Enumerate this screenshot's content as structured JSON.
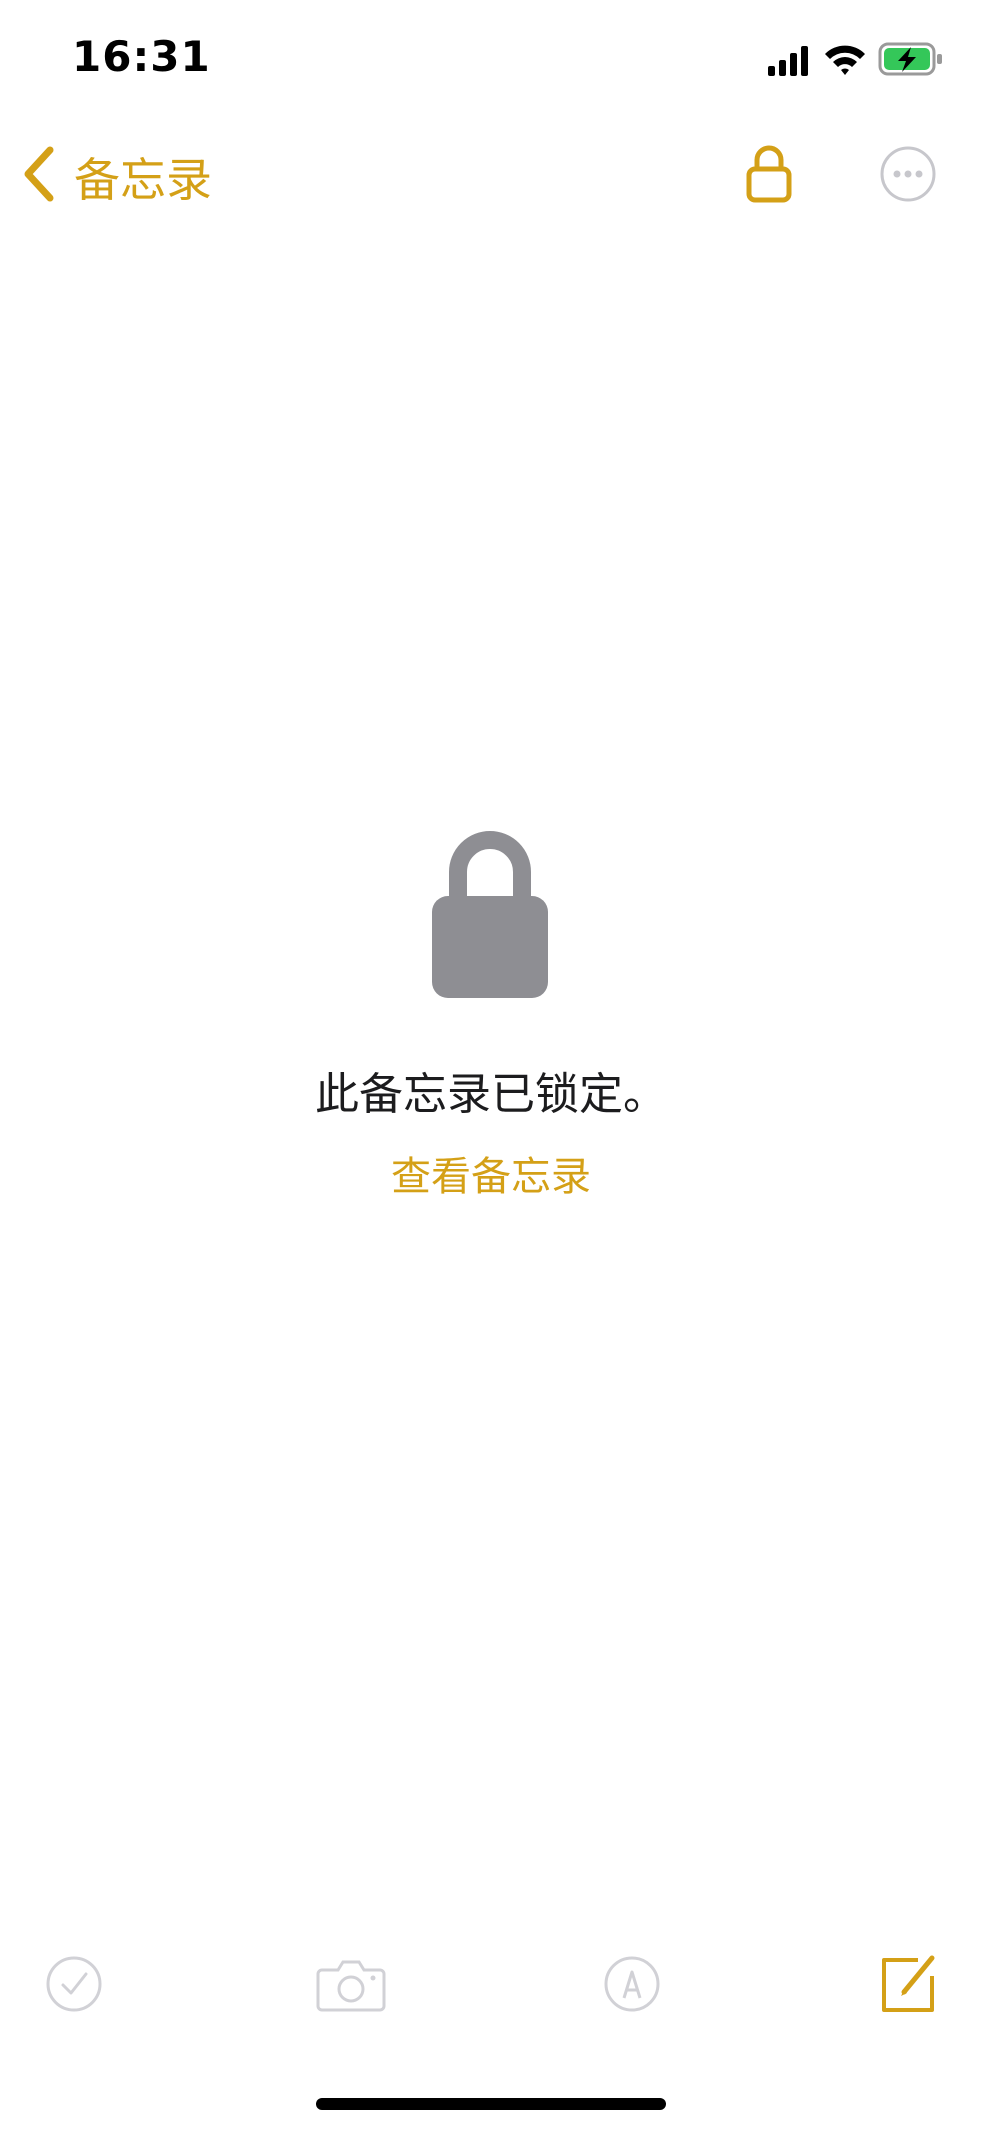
{
  "status_bar": {
    "time": "16:31"
  },
  "nav": {
    "back_label": "备忘录",
    "icons": [
      "chevron-left-icon",
      "lock-open-icon",
      "more-icon"
    ]
  },
  "locked": {
    "message": "此备忘录已锁定。",
    "view_link": "查看备忘录"
  },
  "toolbar": {
    "icons": [
      "checklist-icon",
      "camera-icon",
      "markup-icon",
      "compose-icon"
    ]
  },
  "colors": {
    "accent": "#d4a017",
    "lock_gray": "#8e8e93",
    "disabled_gray": "#d1d1d6"
  }
}
